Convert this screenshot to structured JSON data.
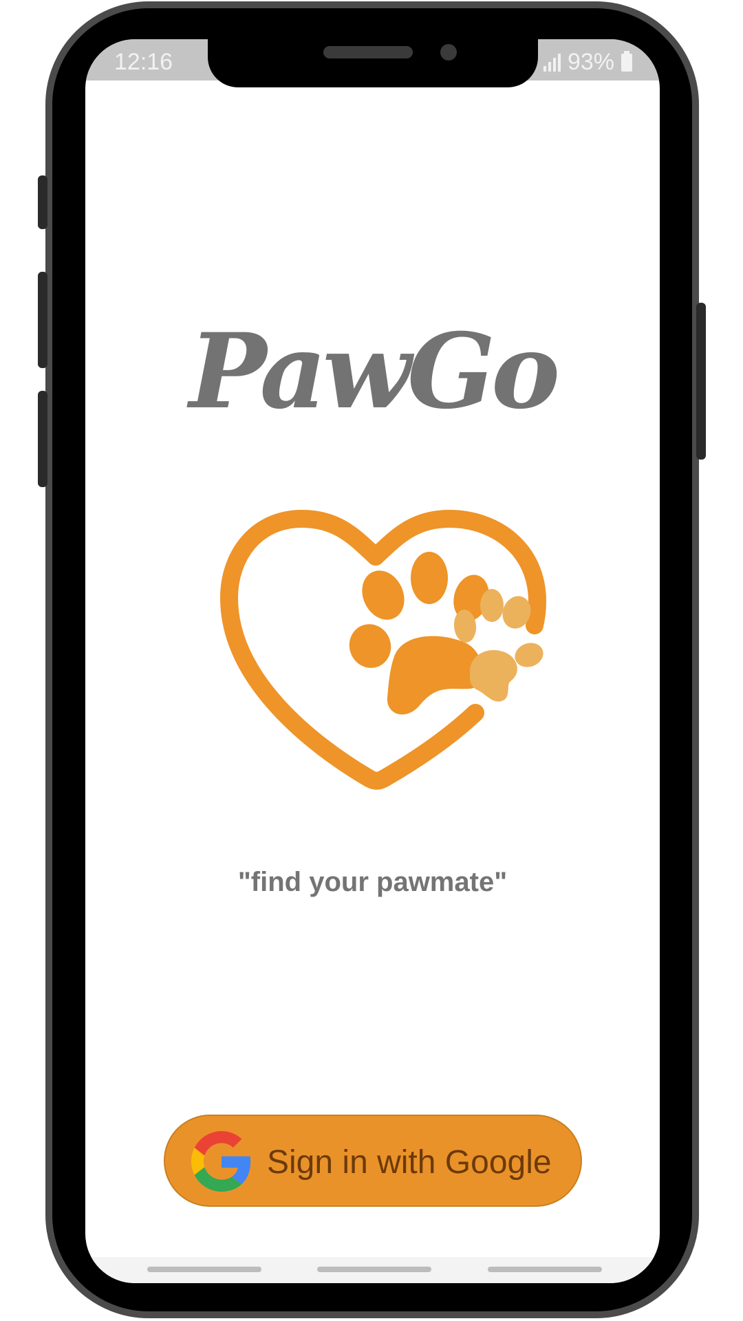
{
  "status_bar": {
    "time": "12:16",
    "battery": "93%",
    "signal_icon": "signal-icon",
    "battery_icon": "battery-icon"
  },
  "app": {
    "title": "PawGo",
    "tagline": "\"find your pawmate\"",
    "logo_icon": "heart-paw-logo",
    "accent_color": "#ea922a"
  },
  "signin": {
    "label": "Sign in with Google",
    "icon": "google-icon"
  }
}
